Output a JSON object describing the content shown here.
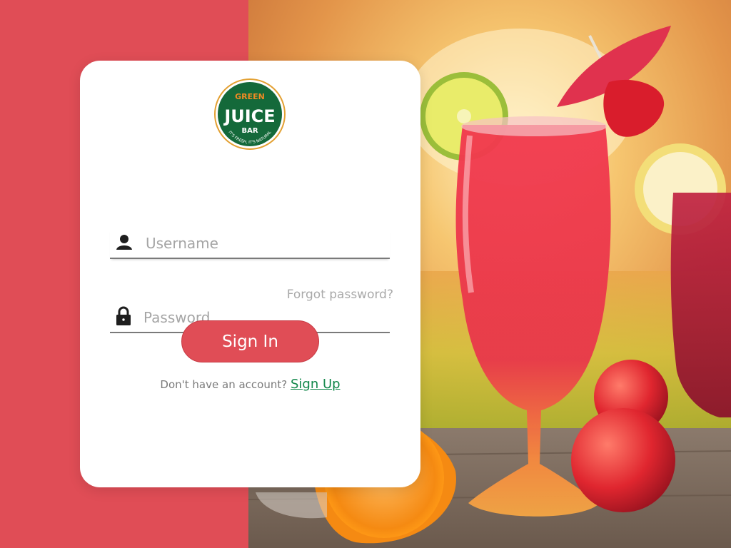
{
  "logo": {
    "line1": "GREEN",
    "line2": "JUICE",
    "line3": "BAR",
    "tagline": "IT'S FRESH, IT'S NATURAL",
    "colors": {
      "green": "#14693a",
      "orange": "#f08a23",
      "ring": "#e3a032"
    }
  },
  "login": {
    "username_placeholder": "Username",
    "password_placeholder": "Password",
    "username_icon": "user-icon",
    "password_icon": "lock-icon",
    "forgot_label": "Forgot password?",
    "signin_label": "Sign In",
    "signup_prompt": "Don't have an account?",
    "signup_link": "Sign Up"
  },
  "theme": {
    "accent": "#e04d56",
    "link_green": "#11874a",
    "card_bg": "#ffffff"
  }
}
